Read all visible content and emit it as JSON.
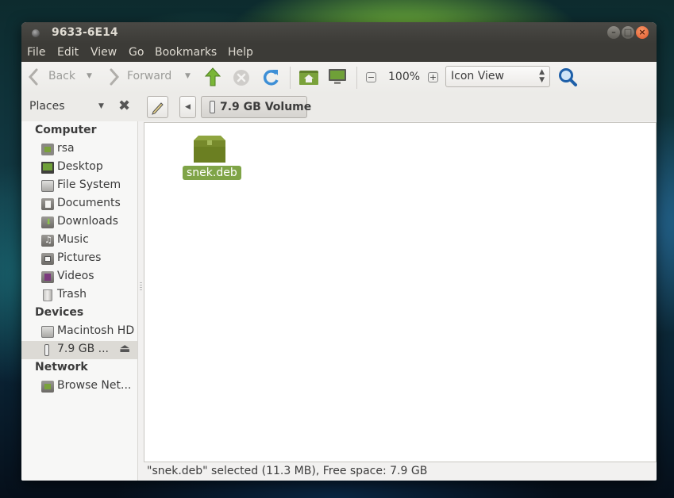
{
  "window": {
    "title": "9633-6E14",
    "minimize_glyph": "–",
    "maximize_glyph": "□",
    "close_glyph": "×"
  },
  "menubar": {
    "items": [
      "File",
      "Edit",
      "View",
      "Go",
      "Bookmarks",
      "Help"
    ]
  },
  "toolbar": {
    "back_label": "Back",
    "forward_label": "Forward",
    "zoom_level": "100%",
    "view_mode": "Icon View",
    "icons": [
      "back-arrow-icon",
      "forward-arrow-icon",
      "up-arrow-icon",
      "stop-icon",
      "reload-icon",
      "home-folder-icon",
      "computer-icon",
      "zoom-out-icon",
      "zoom-in-icon",
      "search-icon"
    ]
  },
  "locationbar": {
    "places_label": "Places",
    "current_path": "7.9 GB Volume"
  },
  "sidebar": {
    "sections": [
      {
        "heading": "Computer",
        "items": [
          {
            "label": "rsa",
            "icon": "home-folder-icon"
          },
          {
            "label": "Desktop",
            "icon": "desktop-icon"
          },
          {
            "label": "File System",
            "icon": "harddisk-icon"
          },
          {
            "label": "Documents",
            "icon": "documents-folder-icon"
          },
          {
            "label": "Downloads",
            "icon": "downloads-folder-icon"
          },
          {
            "label": "Music",
            "icon": "music-folder-icon"
          },
          {
            "label": "Pictures",
            "icon": "pictures-folder-icon"
          },
          {
            "label": "Videos",
            "icon": "videos-folder-icon"
          },
          {
            "label": "Trash",
            "icon": "trash-icon"
          }
        ]
      },
      {
        "heading": "Devices",
        "items": [
          {
            "label": "Macintosh HD",
            "icon": "harddisk-icon"
          },
          {
            "label": "7.9 GB ...",
            "icon": "usb-drive-icon",
            "selected": true
          }
        ]
      },
      {
        "heading": "Network",
        "items": [
          {
            "label": "Browse Net...",
            "icon": "network-folder-icon"
          }
        ]
      }
    ]
  },
  "content": {
    "files": [
      {
        "name": "snek.deb",
        "icon": "package-icon",
        "selected": true
      }
    ]
  },
  "statusbar": {
    "text": "\"snek.deb\" selected (11.3 MB), Free space: 7.9 GB"
  },
  "colors": {
    "accent": "#7fa447",
    "titlebar": "#3c3b37",
    "close_button": "#e2562a",
    "selection_bg": "#dcdad5"
  }
}
